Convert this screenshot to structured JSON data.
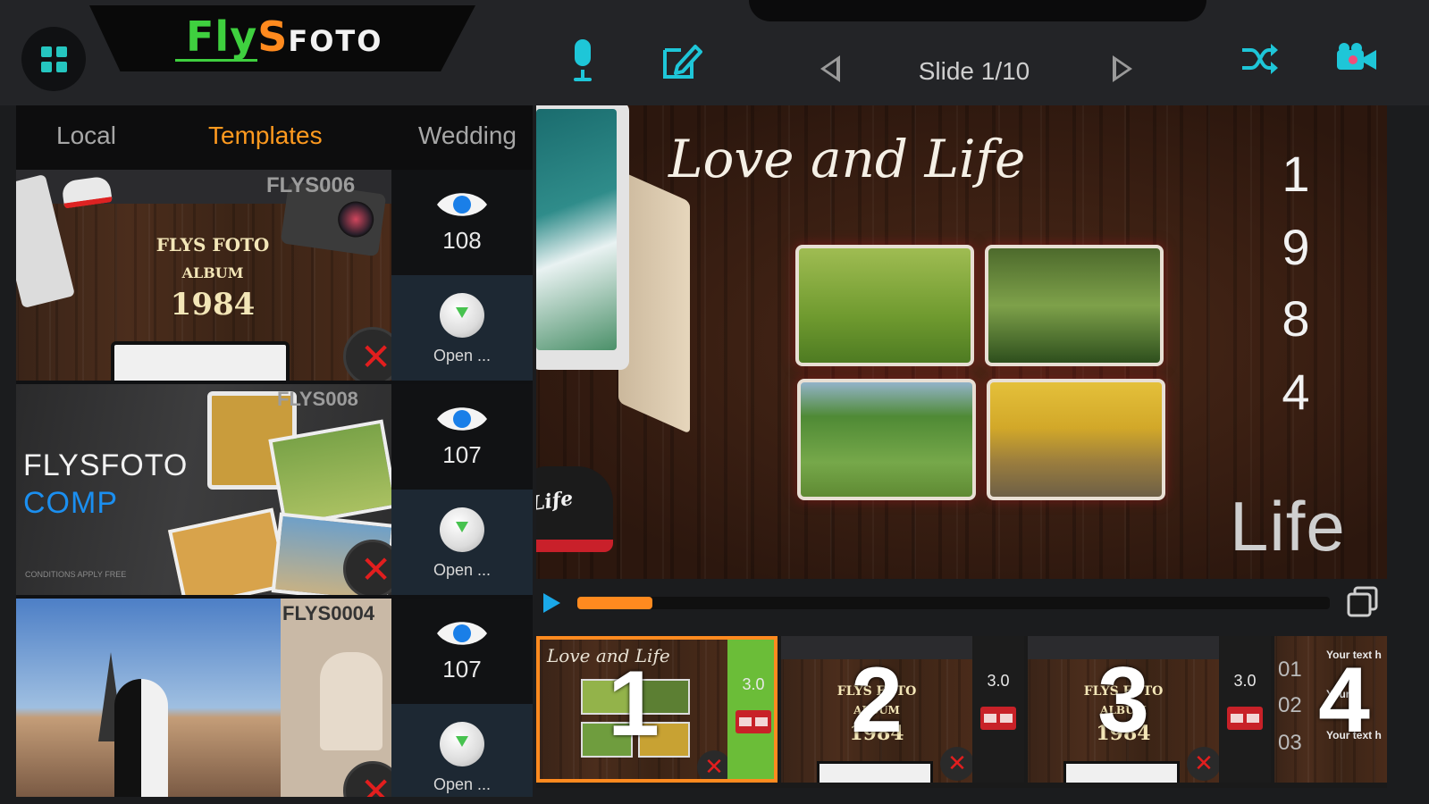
{
  "app": {
    "logo_part1": "Fly",
    "logo_part2": "S",
    "logo_part3": "FOTO"
  },
  "toolbar": {
    "slide_label": "Slide 1/10",
    "icons": [
      "grid-menu-icon",
      "microphone-icon",
      "edit-icon",
      "previous-icon",
      "next-icon",
      "shuffle-icon",
      "video-camera-icon"
    ]
  },
  "tabs": [
    {
      "label": "Local",
      "active": false
    },
    {
      "label": "Templates",
      "active": true
    },
    {
      "label": "Wedding",
      "active": false
    }
  ],
  "templates": [
    {
      "code": "FLYS006",
      "title_line1": "FLYS FOTO",
      "title_line2": "ALBUM",
      "title_line3": "1984",
      "views": "108",
      "open_label": "Open ..."
    },
    {
      "code": "FLYS008",
      "title_line1": "FLYSFOTO",
      "title_line2": "COMP",
      "footnote": "CONDITIONS APPLY FREE",
      "views": "107",
      "open_label": "Open ..."
    },
    {
      "code": "FLYS0004",
      "views": "107",
      "open_label": "Open ..."
    }
  ],
  "preview": {
    "title": "Love and Life",
    "vertical_digits": [
      "1",
      "9",
      "8",
      "4"
    ],
    "corner_text": "Life",
    "cap_text": "Life"
  },
  "playback": {
    "progress_percent": 10
  },
  "filmstrip": [
    {
      "number": "1",
      "duration": "3.0",
      "selected": true,
      "mini_title": "Love and Life"
    },
    {
      "number": "2",
      "duration": "3.0",
      "selected": false,
      "mini_line1": "FLYS FOTO",
      "mini_line2": "ALBUM",
      "mini_line3": "1984"
    },
    {
      "number": "3",
      "duration": "3.0",
      "selected": false,
      "mini_line1": "FLYS FOTO",
      "mini_line2": "ALBUM",
      "mini_line3": "1984"
    },
    {
      "number": "4",
      "selected": false,
      "rows": [
        "01",
        "02",
        "03"
      ],
      "row_text": [
        "Your text h",
        "Your",
        "Your text h"
      ]
    }
  ],
  "colors": {
    "accent_orange": "#ff8a1f",
    "accent_teal": "#1ec6d8",
    "play_blue": "#1aa8e8",
    "delete_red": "#e21e1e",
    "selected_duration_green": "#6bbd38"
  }
}
